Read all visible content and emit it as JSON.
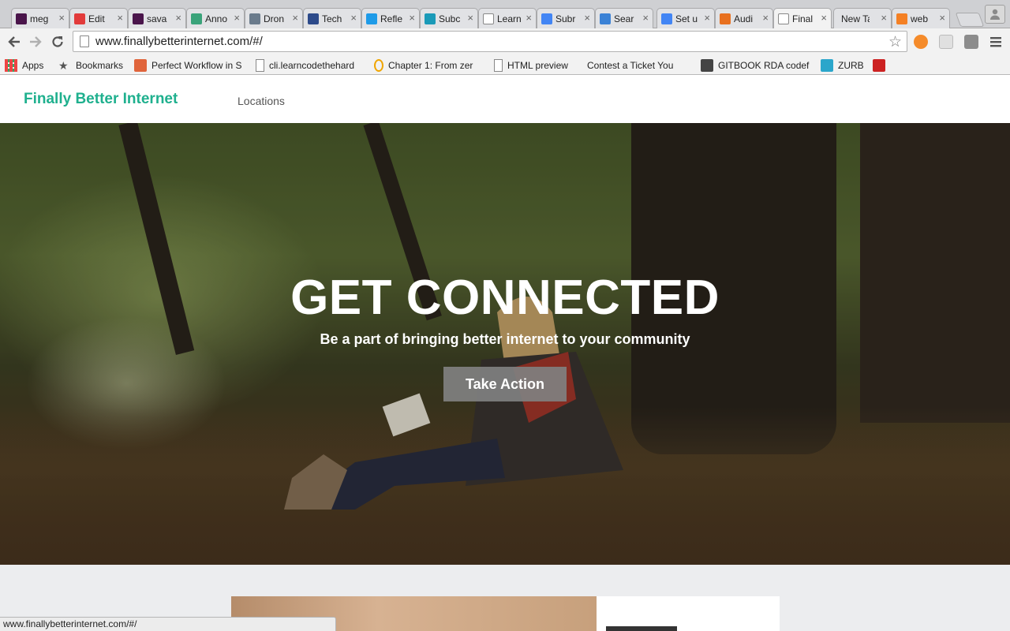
{
  "browser": {
    "tabs": [
      {
        "title": "meg",
        "icon": "slack-icon",
        "color": "#4a154b"
      },
      {
        "title": "Edit",
        "icon": "lifebuoy-icon",
        "color": "#e23b3b"
      },
      {
        "title": "sava",
        "icon": "slack-icon",
        "color": "#4a154b"
      },
      {
        "title": "Anno",
        "icon": "mountain-icon",
        "color": "#3aa37a"
      },
      {
        "title": "Dron",
        "icon": "drone-icon",
        "color": "#6a7b8c"
      },
      {
        "title": "Tech",
        "icon": "gear-circle-icon",
        "color": "#2c4a8a"
      },
      {
        "title": "Refle",
        "icon": "droplet-icon",
        "color": "#1e9be8"
      },
      {
        "title": "Subc",
        "icon": "s-circle-icon",
        "color": "#1a9ab8"
      },
      {
        "title": "Learn",
        "icon": "page-icon",
        "color": "#999999"
      },
      {
        "title": "Subr",
        "icon": "google-icon",
        "color": "#4285f4"
      },
      {
        "title": "Sear",
        "icon": "calendar-icon",
        "color": "#3b82d6"
      },
      {
        "title": "Set u",
        "icon": "google-icon",
        "color": "#4285f4"
      },
      {
        "title": "Audi",
        "icon": "chart-icon",
        "color": "#e8701f"
      },
      {
        "title": "Final",
        "icon": "page-icon",
        "color": "#999999",
        "active": true
      },
      {
        "title": "New Ta",
        "icon": "none",
        "color": "#cccccc"
      },
      {
        "title": "web",
        "icon": "stack-icon",
        "color": "#f48024"
      }
    ],
    "url": "www.finallybetterinternet.com/#/",
    "bookmarks": [
      {
        "label": "Apps",
        "icon": "apps-grid-icon",
        "color": "#777777"
      },
      {
        "label": "Bookmarks",
        "icon": "star-icon",
        "color": "#555555"
      },
      {
        "label": "Perfect Workflow in S",
        "icon": "plus-square-icon",
        "color": "#e0643b"
      },
      {
        "label": "cli.learncodethehard",
        "icon": "page-icon",
        "color": "#999999"
      },
      {
        "label": "Chapter 1: From zer",
        "icon": "circle-icon",
        "color": "#f0a500"
      },
      {
        "label": "HTML preview",
        "icon": "page-icon",
        "color": "#999999"
      },
      {
        "label": "Contest a Ticket You",
        "icon": "none",
        "color": "#cccccc"
      },
      {
        "label": "GITBOOK RDA codef",
        "icon": "book-icon",
        "color": "#444444"
      },
      {
        "label": "ZURB",
        "icon": "zurb-icon",
        "color": "#2ba6cb"
      },
      {
        "label": "",
        "icon": "ruby-icon",
        "color": "#cc2222"
      }
    ],
    "status_text": "www.finallybetterinternet.com/#/"
  },
  "site": {
    "brand": "Finally Better Internet",
    "brand_color": "#1fb08e",
    "nav": [
      "Locations"
    ],
    "hero": {
      "title": "GET CONNECTED",
      "subtitle": "Be a part of bringing better internet to your community",
      "cta": "Take Action"
    }
  }
}
